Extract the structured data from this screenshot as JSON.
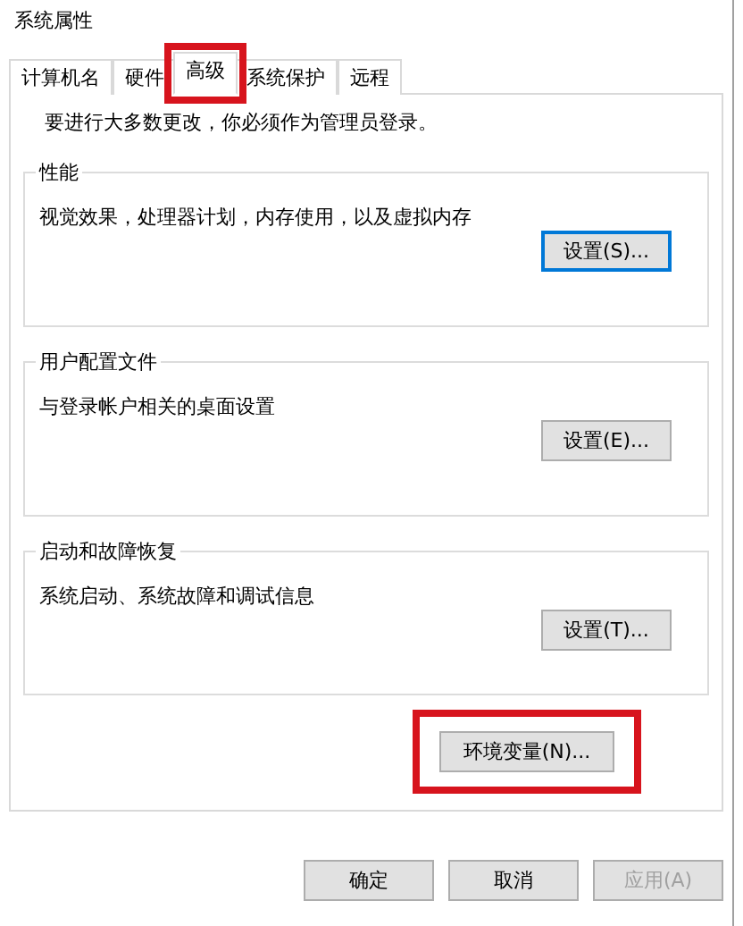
{
  "window": {
    "title": "系统属性"
  },
  "tabs": [
    {
      "label": "计算机名",
      "selected": false,
      "highlighted": false
    },
    {
      "label": "硬件",
      "selected": false,
      "highlighted": false
    },
    {
      "label": "高级",
      "selected": true,
      "highlighted": true
    },
    {
      "label": "系统保护",
      "selected": false,
      "highlighted": false
    },
    {
      "label": "远程",
      "selected": false,
      "highlighted": false
    }
  ],
  "notice": "要进行大多数更改，你必须作为管理员登录。",
  "groups": [
    {
      "title": "性能",
      "description": "视觉效果，处理器计划，内存使用，以及虚拟内存",
      "button": {
        "label": "设置(S)...",
        "focused": true
      }
    },
    {
      "title": "用户配置文件",
      "description": "与登录帐户相关的桌面设置",
      "button": {
        "label": "设置(E)...",
        "focused": false
      }
    },
    {
      "title": "启动和故障恢复",
      "description": "系统启动、系统故障和调试信息",
      "button": {
        "label": "设置(T)...",
        "focused": false
      }
    }
  ],
  "environment_button": {
    "label": "环境变量(N)...",
    "highlighted": true
  },
  "footer_buttons": [
    {
      "label": "确定",
      "disabled": false
    },
    {
      "label": "取消",
      "disabled": false
    },
    {
      "label": "应用(A)",
      "disabled": true
    }
  ]
}
